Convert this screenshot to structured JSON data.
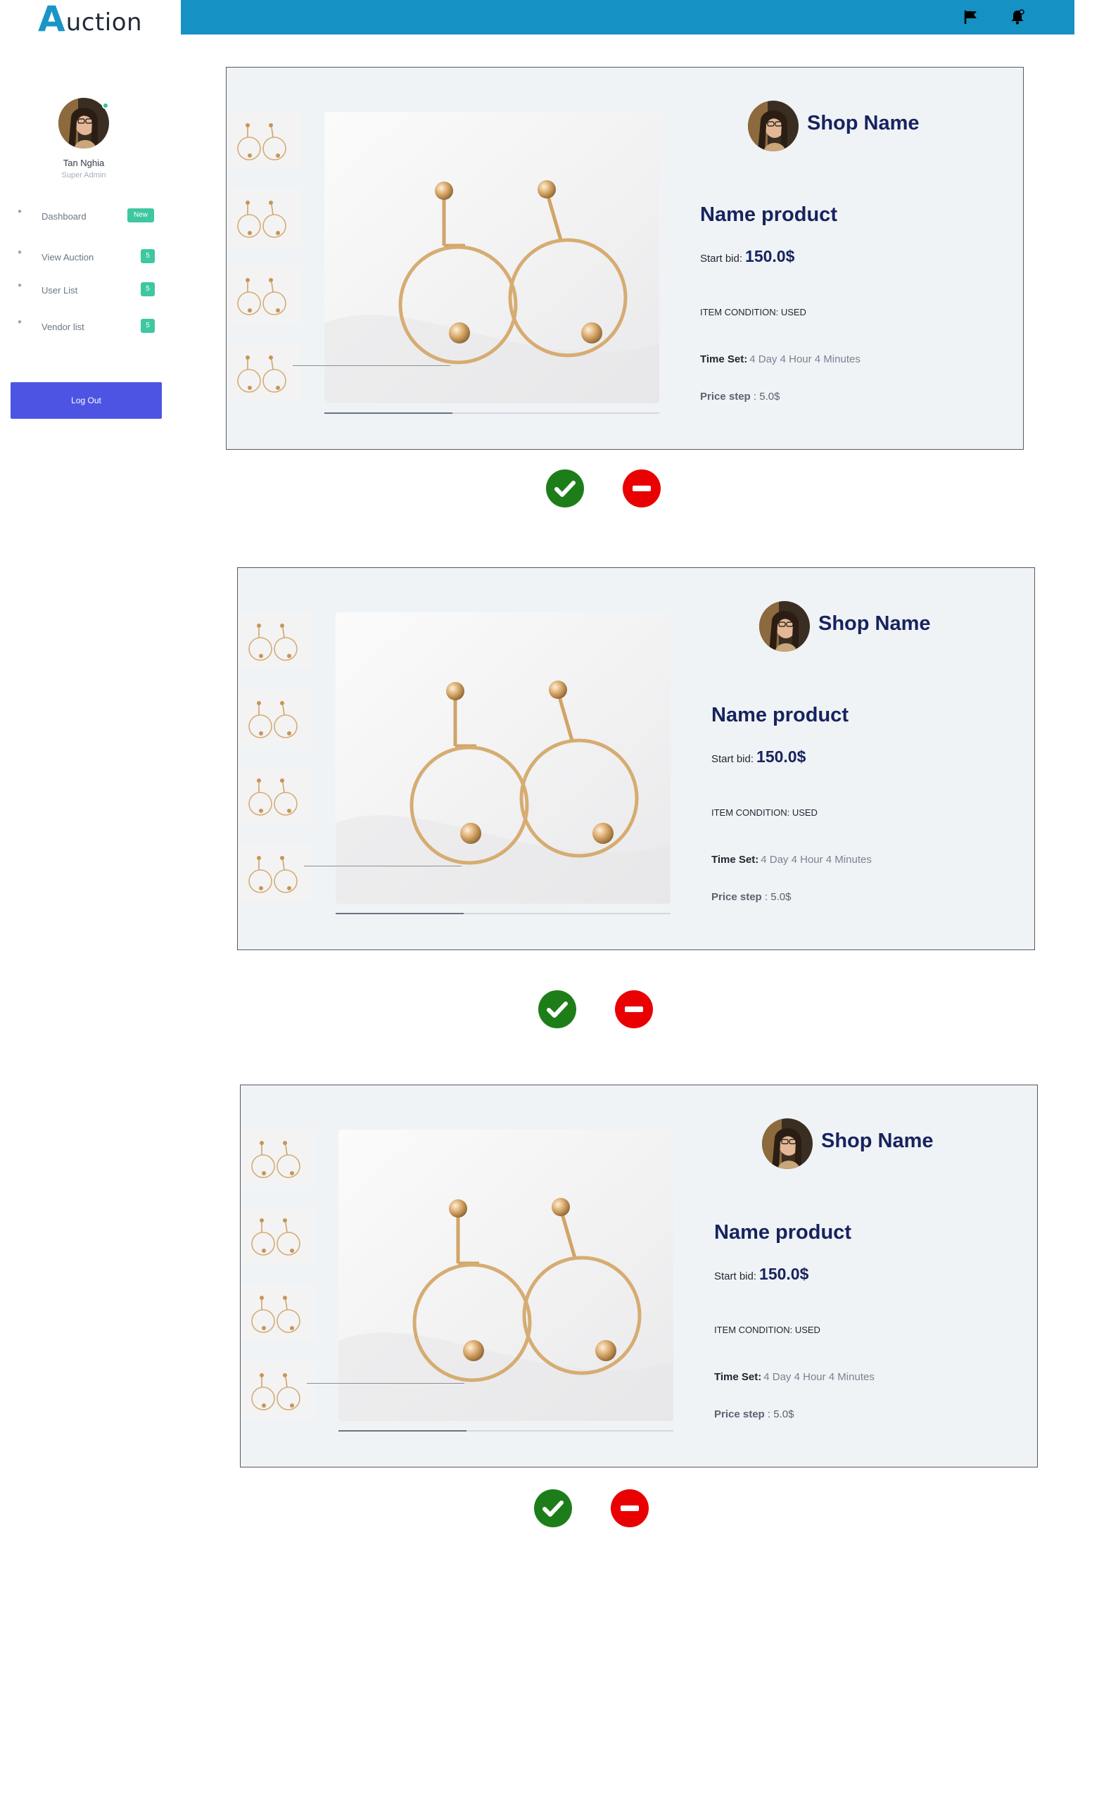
{
  "header": {
    "logo_first_letter": "A",
    "logo_rest": "uction",
    "icons": [
      "flag-icon",
      "bell-icon"
    ]
  },
  "sidebar": {
    "profile_name": "Tan Nghia",
    "profile_role": "Super Admin",
    "items": [
      {
        "label": "Dashboard",
        "badge": "New"
      },
      {
        "label": "View Auction",
        "badge": "5"
      },
      {
        "label": "User List",
        "badge": "5"
      },
      {
        "label": "Vendor list",
        "badge": "5"
      }
    ],
    "logout_label": "Log Out"
  },
  "products": [
    {
      "shop_name": "Shop Name",
      "product_name": "Name product",
      "start_bid_label": "Start bid:",
      "start_bid_value": "150.0$",
      "condition_text": "ITEM CONDITION: USED",
      "time_set_label": "Time Set:",
      "time_set_value": "4 Day 4 Hour 4 Minutes",
      "price_step_label": "Price step",
      "price_step_value": ": 5.0$"
    },
    {
      "shop_name": "Shop Name",
      "product_name": "Name product",
      "start_bid_label": "Start bid:",
      "start_bid_value": "150.0$",
      "condition_text": "ITEM CONDITION: USED",
      "time_set_label": "Time Set:",
      "time_set_value": "4 Day 4 Hour 4 Minutes",
      "price_step_label": "Price step",
      "price_step_value": ": 5.0$"
    },
    {
      "shop_name": "Shop Name",
      "product_name": "Name product",
      "start_bid_label": "Start bid:",
      "start_bid_value": "150.0$",
      "condition_text": "ITEM CONDITION: USED",
      "time_set_label": "Time Set:",
      "time_set_value": "4 Day 4 Hour 4 Minutes",
      "price_step_label": "Price step",
      "price_step_value": ": 5.0$"
    }
  ],
  "actions": {
    "approve_icon": "check-icon",
    "reject_icon": "minus-icon",
    "approve_color": "#1d7e19",
    "reject_color": "#e90000"
  },
  "colors": {
    "topbar": "#1591c3",
    "brand_text": "#17235e",
    "badge": "#3ec7a1",
    "logout": "#4d54e3"
  }
}
